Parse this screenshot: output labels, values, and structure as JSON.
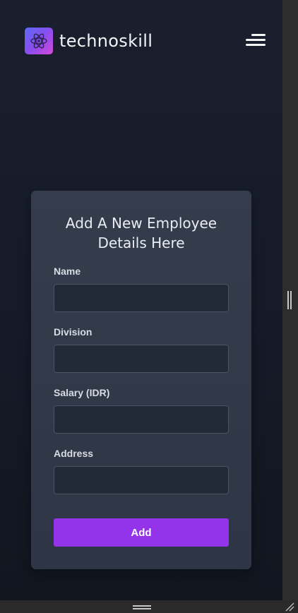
{
  "header": {
    "brand": "technoskill",
    "logo_icon": "atom-icon",
    "menu_icon": "hamburger-menu-icon"
  },
  "form": {
    "title": "Add A New Employee Details Here",
    "fields": [
      {
        "label": "Name",
        "value": "",
        "placeholder": ""
      },
      {
        "label": "Division",
        "value": "",
        "placeholder": ""
      },
      {
        "label": "Salary (IDR)",
        "value": "",
        "placeholder": ""
      },
      {
        "label": "Address",
        "value": "",
        "placeholder": ""
      }
    ],
    "submit_label": "Add"
  },
  "colors": {
    "background": "#151b27",
    "card": "#323a4a",
    "accent": "#9333ea",
    "logo_gradient_start": "#5b6cf5",
    "logo_gradient_end": "#d54ad8"
  }
}
